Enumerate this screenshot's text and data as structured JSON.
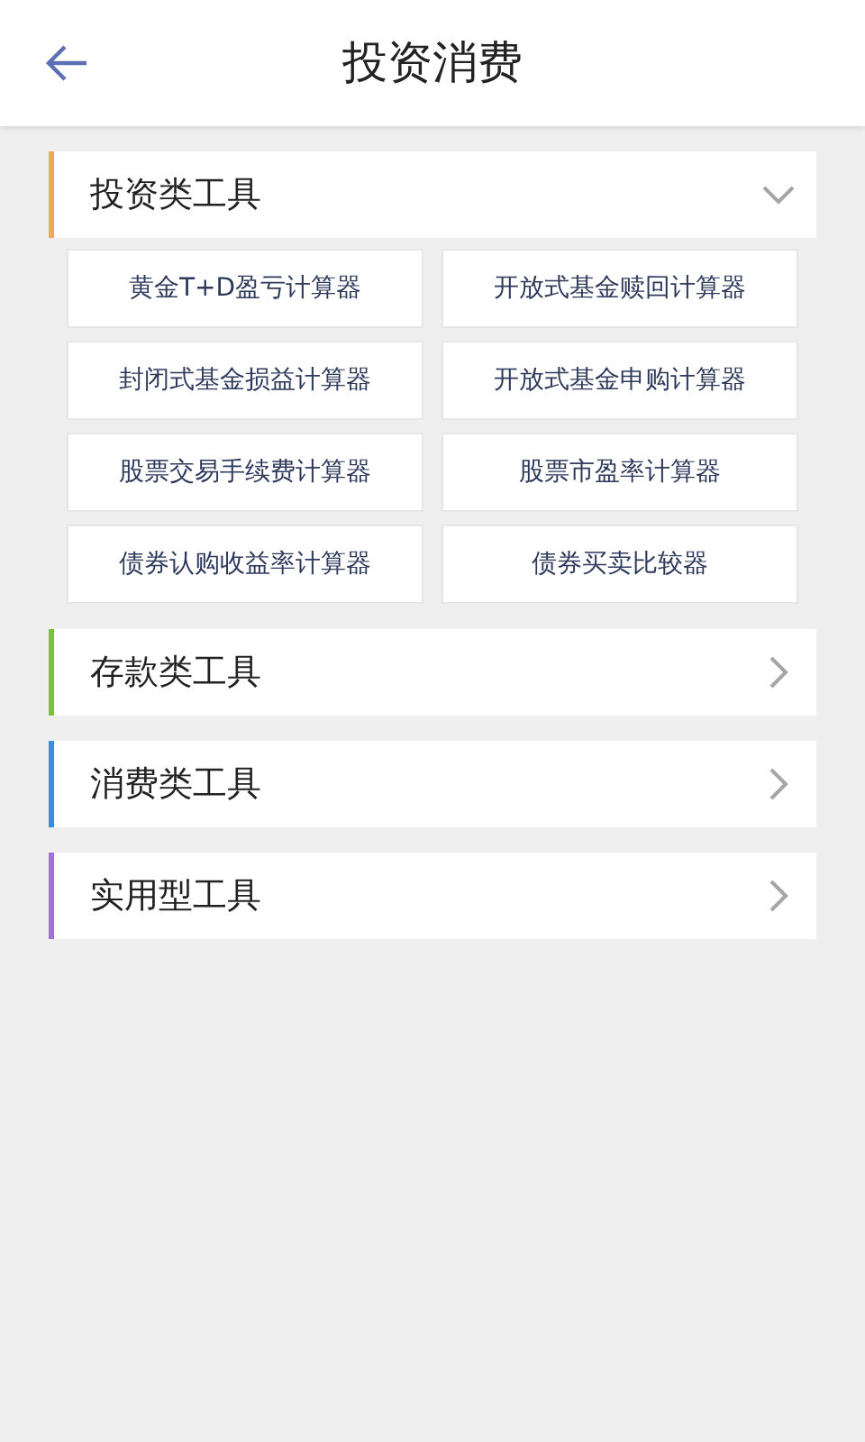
{
  "header": {
    "title": "投资消费"
  },
  "sections": [
    {
      "title": "投资类工具",
      "color": "#f0a94e",
      "expanded": true,
      "tools": [
        "黄金T+D盈亏计算器",
        "开放式基金赎回计算器",
        "封闭式基金损益计算器",
        "开放式基金申购计算器",
        "股票交易手续费计算器",
        "股票市盈率计算器",
        "债券认购收益率计算器",
        "债券买卖比较器"
      ]
    },
    {
      "title": "存款类工具",
      "color": "#7cc13a",
      "expanded": false
    },
    {
      "title": "消费类工具",
      "color": "#3a8ee0",
      "expanded": false
    },
    {
      "title": "实用型工具",
      "color": "#a36ee0",
      "expanded": false
    }
  ]
}
